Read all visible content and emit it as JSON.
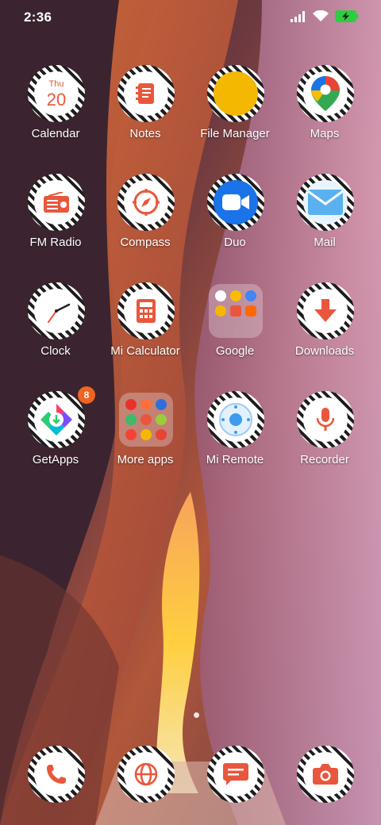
{
  "status_bar": {
    "time": "2:36",
    "icons": [
      "signal-icon",
      "wifi-icon",
      "battery-charging-icon"
    ],
    "battery_color": "#2ecc40"
  },
  "calendar_icon": {
    "day": "Thu",
    "date": "20"
  },
  "accent": "#e8573c",
  "apps": [
    {
      "label": "Calendar",
      "icon": "calendar-icon"
    },
    {
      "label": "Notes",
      "icon": "notes-icon"
    },
    {
      "label": "File Manager",
      "icon": "file-manager-icon"
    },
    {
      "label": "Maps",
      "icon": "maps-icon"
    },
    {
      "label": "FM Radio",
      "icon": "radio-icon"
    },
    {
      "label": "Compass",
      "icon": "compass-icon"
    },
    {
      "label": "Duo",
      "icon": "video-camera-icon"
    },
    {
      "label": "Mail",
      "icon": "mail-icon"
    },
    {
      "label": "Clock",
      "icon": "clock-icon"
    },
    {
      "label": "Mi Calculator",
      "icon": "calculator-icon"
    },
    {
      "label": "Google",
      "icon": "folder-icon"
    },
    {
      "label": "Downloads",
      "icon": "download-icon"
    },
    {
      "label": "GetApps",
      "icon": "getapps-icon",
      "badge": "8"
    },
    {
      "label": "More apps",
      "icon": "folder-icon"
    },
    {
      "label": "Mi Remote",
      "icon": "remote-icon"
    },
    {
      "label": "Recorder",
      "icon": "microphone-icon"
    }
  ],
  "dock": [
    {
      "icon": "phone-icon"
    },
    {
      "icon": "browser-icon"
    },
    {
      "icon": "messages-icon"
    },
    {
      "icon": "camera-icon"
    }
  ]
}
